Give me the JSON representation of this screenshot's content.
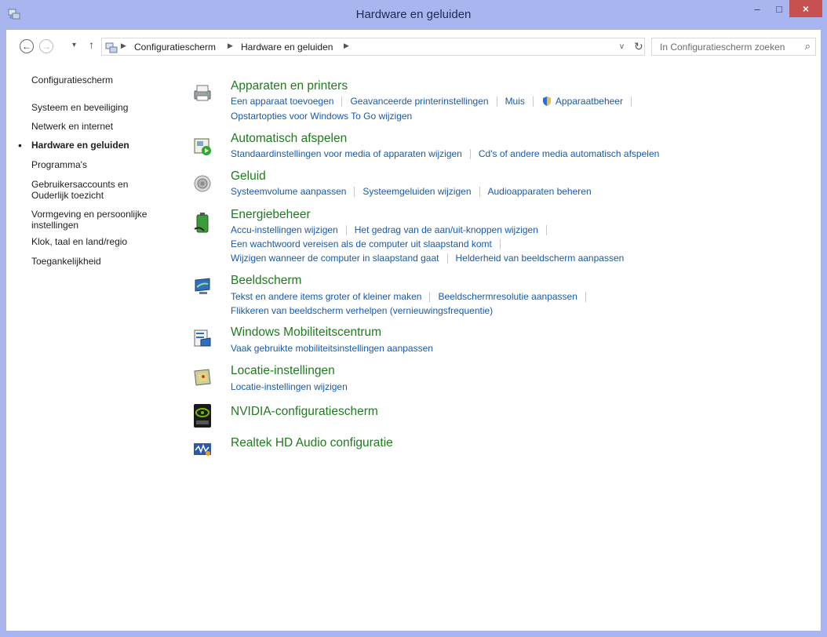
{
  "window": {
    "title": "Hardware en geluiden"
  },
  "titlebar": {
    "minimize": "–",
    "maximize": "□",
    "close": "×"
  },
  "address": {
    "crumbs": [
      "Configuratiescherm",
      "Hardware en geluiden"
    ],
    "search_placeholder": "In Configuratiescherm zoeken"
  },
  "sidebar": {
    "items": [
      "Configuratiescherm",
      "Systeem en beveiliging",
      "Netwerk en internet",
      "Hardware en geluiden",
      "Programma's",
      "Gebruikersaccounts en Ouderlijk toezicht",
      "Vormgeving en persoonlijke instellingen",
      "Klok, taal en land/regio",
      "Toegankelijkheid"
    ],
    "active_index": 3
  },
  "categories": [
    {
      "title": "Apparaten en printers",
      "rows": [
        [
          "Een apparaat toevoegen",
          "Geavanceerde printerinstellingen",
          "Muis",
          "Apparaatbeheer"
        ],
        [
          "Opstartopties voor Windows To Go wijzigen"
        ]
      ]
    },
    {
      "title": "Automatisch afspelen",
      "rows": [
        [
          "Standaardinstellingen voor media of apparaten wijzigen",
          "Cd's of andere media automatisch afspelen"
        ]
      ]
    },
    {
      "title": "Geluid",
      "rows": [
        [
          "Systeemvolume aanpassen",
          "Systeemgeluiden wijzigen",
          "Audioapparaten beheren"
        ]
      ]
    },
    {
      "title": "Energiebeheer",
      "rows": [
        [
          "Accu-instellingen wijzigen",
          "Het gedrag van de aan/uit-knoppen wijzigen"
        ],
        [
          "Een wachtwoord vereisen als de computer uit slaapstand komt"
        ],
        [
          "Wijzigen wanneer de computer in slaapstand gaat",
          "Helderheid van beeldscherm aanpassen"
        ]
      ]
    },
    {
      "title": "Beeldscherm",
      "rows": [
        [
          "Tekst en andere items groter of kleiner maken",
          "Beeldschermresolutie aanpassen"
        ],
        [
          "Flikkeren van beeldscherm verhelpen (vernieuwingsfrequentie)"
        ]
      ]
    },
    {
      "title": "Windows Mobiliteitscentrum",
      "rows": [
        [
          "Vaak gebruikte mobiliteitsinstellingen aanpassen"
        ]
      ]
    },
    {
      "title": "Locatie-instellingen",
      "rows": [
        [
          "Locatie-instellingen wijzigen"
        ]
      ]
    },
    {
      "title": "NVIDIA-configuratiescherm",
      "rows": []
    },
    {
      "title": "Realtek HD Audio configuratie",
      "rows": []
    }
  ]
}
